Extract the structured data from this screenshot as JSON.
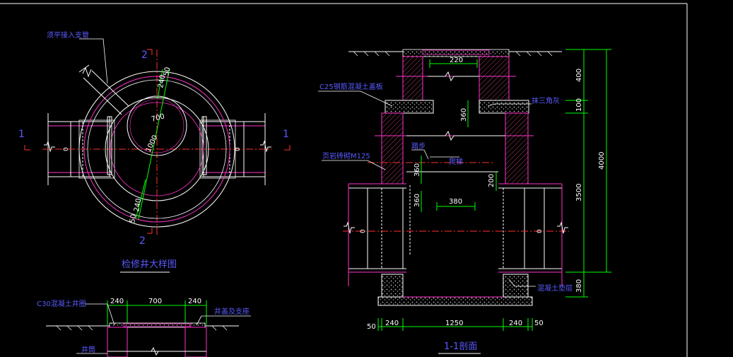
{
  "colors": {
    "background": "#000000",
    "frame": "#ffffff",
    "outline": "#ffffff",
    "dimension": "#00ff00",
    "text": "#ffffff",
    "label": "#5a5aff",
    "brick": "#ff33cc",
    "concrete": "#b8b8b8",
    "centerline": "#ff3030",
    "section_mark": "#ff3030",
    "hidden": "#c8c800"
  },
  "plan_view": {
    "title": "检修井大样图",
    "pipe_label": "须平接入支管",
    "section_mark_left": "1",
    "section_mark_right": "1",
    "section_mark_top": "2",
    "section_mark_bottom": "2",
    "dim_240_top": "240",
    "dim_50_top": "50",
    "dim_700": "700",
    "dim_1000": "1000",
    "dim_240_bottom": "240",
    "dim_50_bottom": "50",
    "pipe_left_mark": "0",
    "pipe_right_mark": "0"
  },
  "section_2_view": {
    "label_c30": "C30混凝土井圈",
    "label_cover": "井盖及支座",
    "label_wall": "井筒",
    "dim_240_left": "240",
    "dim_700": "700",
    "dim_240_right": "240"
  },
  "section_1_view": {
    "title": "1-1剖面",
    "label_c25": "C25钢筋混凝土盖板",
    "label_brick": "页岩砖砌M125",
    "label_mortar": "抹三角灰",
    "label_ladder": "爬梯",
    "label_step": "踏步",
    "label_base": "混凝土垫层",
    "dim_220": "220",
    "dim_360_a": "360",
    "dim_360_b": "360",
    "dim_360_c": "360",
    "dim_380_inner": "380",
    "dim_200": "200",
    "dim_400": "400",
    "dim_100": "100",
    "dim_3500": "3500",
    "dim_4000": "4000",
    "dim_380_right": "380",
    "dim_50_left": "50",
    "dim_240_left": "240",
    "dim_1250": "1250",
    "dim_240_right": "240",
    "dim_50_right": "50",
    "pipe_left_mark": "0",
    "pipe_right_mark": "0"
  }
}
